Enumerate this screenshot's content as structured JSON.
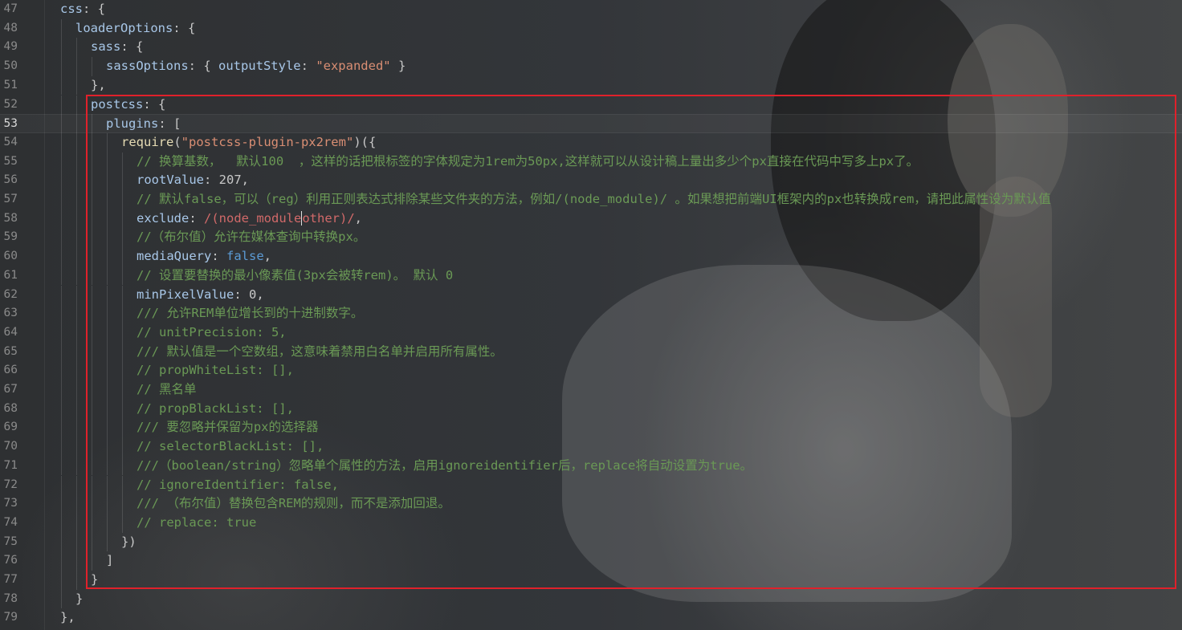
{
  "editor": {
    "theme_colors": {
      "property": "#a8c7e8",
      "function": "#e6dcb4",
      "string": "#d98e73",
      "keyword_bool": "#5b9bd5",
      "regex": "#d16969",
      "comment": "#6a9955",
      "highlight_box": "#e0212b"
    },
    "current_line_number": "53",
    "lines": [
      {
        "n": "47",
        "indent": 0,
        "tokens": [
          {
            "t": "key",
            "v": "css"
          },
          {
            "t": "punct",
            "v": ": {"
          }
        ]
      },
      {
        "n": "48",
        "indent": 1,
        "tokens": [
          {
            "t": "key",
            "v": "loaderOptions"
          },
          {
            "t": "punct",
            "v": ": {"
          }
        ]
      },
      {
        "n": "49",
        "indent": 2,
        "tokens": [
          {
            "t": "key",
            "v": "sass"
          },
          {
            "t": "punct",
            "v": ": {"
          }
        ]
      },
      {
        "n": "50",
        "indent": 3,
        "tokens": [
          {
            "t": "key",
            "v": "sassOptions"
          },
          {
            "t": "punct",
            "v": ": { "
          },
          {
            "t": "key",
            "v": "outputStyle"
          },
          {
            "t": "punct",
            "v": ": "
          },
          {
            "t": "str",
            "v": "\"expanded\""
          },
          {
            "t": "punct",
            "v": " }"
          }
        ]
      },
      {
        "n": "51",
        "indent": 2,
        "tokens": [
          {
            "t": "punct",
            "v": "},"
          }
        ]
      },
      {
        "n": "52",
        "indent": 2,
        "tokens": [
          {
            "t": "key",
            "v": "postcss"
          },
          {
            "t": "punct",
            "v": ": {"
          }
        ]
      },
      {
        "n": "53",
        "indent": 3,
        "tokens": [
          {
            "t": "key",
            "v": "plugins"
          },
          {
            "t": "punct",
            "v": ": ["
          }
        ]
      },
      {
        "n": "54",
        "indent": 4,
        "tokens": [
          {
            "t": "fn",
            "v": "require"
          },
          {
            "t": "punct",
            "v": "("
          },
          {
            "t": "str",
            "v": "\"postcss-plugin-px2rem\""
          },
          {
            "t": "punct",
            "v": ")({"
          }
        ]
      },
      {
        "n": "55",
        "indent": 5,
        "tokens": [
          {
            "t": "cm",
            "v": "// 换算基数，  默认100  ，这样的话把根标签的字体规定为1rem为50px,这样就可以从设计稿上量出多少个px直接在代码中写多上px了。"
          }
        ]
      },
      {
        "n": "56",
        "indent": 5,
        "tokens": [
          {
            "t": "key",
            "v": "rootValue"
          },
          {
            "t": "punct",
            "v": ": "
          },
          {
            "t": "num",
            "v": "207"
          },
          {
            "t": "punct",
            "v": ","
          }
        ]
      },
      {
        "n": "57",
        "indent": 5,
        "tokens": [
          {
            "t": "cm",
            "v": "// 默认false，可以（reg）利用正则表达式排除某些文件夹的方法，例如/(node_module)/ 。如果想把前端UI框架内的px也转换成rem，请把此属性设为默认值"
          }
        ]
      },
      {
        "n": "58",
        "indent": 5,
        "tokens": [
          {
            "t": "key",
            "v": "exclude"
          },
          {
            "t": "punct",
            "v": ": "
          },
          {
            "t": "regex",
            "v": "/(node_module"
          },
          {
            "t": "cursor",
            "v": ""
          },
          {
            "t": "regex",
            "v": "other)/"
          },
          {
            "t": "punct",
            "v": ","
          }
        ]
      },
      {
        "n": "59",
        "indent": 5,
        "tokens": [
          {
            "t": "cm",
            "v": "//（布尔值）允许在媒体查询中转换px。"
          }
        ]
      },
      {
        "n": "60",
        "indent": 5,
        "tokens": [
          {
            "t": "key",
            "v": "mediaQuery"
          },
          {
            "t": "punct",
            "v": ": "
          },
          {
            "t": "bool",
            "v": "false"
          },
          {
            "t": "punct",
            "v": ","
          }
        ]
      },
      {
        "n": "61",
        "indent": 5,
        "tokens": [
          {
            "t": "cm",
            "v": "// 设置要替换的最小像素值(3px会被转rem)。 默认 0"
          }
        ]
      },
      {
        "n": "62",
        "indent": 5,
        "tokens": [
          {
            "t": "key",
            "v": "minPixelValue"
          },
          {
            "t": "punct",
            "v": ": "
          },
          {
            "t": "num",
            "v": "0"
          },
          {
            "t": "punct",
            "v": ","
          }
        ]
      },
      {
        "n": "63",
        "indent": 5,
        "tokens": [
          {
            "t": "cm",
            "v": "/// 允许REM单位增长到的十进制数字。"
          }
        ]
      },
      {
        "n": "64",
        "indent": 5,
        "tokens": [
          {
            "t": "cm",
            "v": "// unitPrecision: 5,"
          }
        ]
      },
      {
        "n": "65",
        "indent": 5,
        "tokens": [
          {
            "t": "cm",
            "v": "/// 默认值是一个空数组，这意味着禁用白名单并启用所有属性。"
          }
        ]
      },
      {
        "n": "66",
        "indent": 5,
        "tokens": [
          {
            "t": "cm",
            "v": "// propWhiteList: [],"
          }
        ]
      },
      {
        "n": "67",
        "indent": 5,
        "tokens": [
          {
            "t": "cm",
            "v": "// 黑名单"
          }
        ]
      },
      {
        "n": "68",
        "indent": 5,
        "tokens": [
          {
            "t": "cm",
            "v": "// propBlackList: [],"
          }
        ]
      },
      {
        "n": "69",
        "indent": 5,
        "tokens": [
          {
            "t": "cm",
            "v": "/// 要忽略并保留为px的选择器"
          }
        ]
      },
      {
        "n": "70",
        "indent": 5,
        "tokens": [
          {
            "t": "cm",
            "v": "// selectorBlackList: [],"
          }
        ]
      },
      {
        "n": "71",
        "indent": 5,
        "tokens": [
          {
            "t": "cm",
            "v": "///（boolean/string）忽略单个属性的方法，启用ignoreidentifier后，replace将自动设置为true。"
          }
        ]
      },
      {
        "n": "72",
        "indent": 5,
        "tokens": [
          {
            "t": "cm",
            "v": "// ignoreIdentifier: false,"
          }
        ]
      },
      {
        "n": "73",
        "indent": 5,
        "tokens": [
          {
            "t": "cm",
            "v": "/// （布尔值）替换包含REM的规则，而不是添加回退。"
          }
        ]
      },
      {
        "n": "74",
        "indent": 5,
        "tokens": [
          {
            "t": "cm",
            "v": "// replace: true"
          }
        ]
      },
      {
        "n": "75",
        "indent": 4,
        "tokens": [
          {
            "t": "punct",
            "v": "})"
          }
        ]
      },
      {
        "n": "76",
        "indent": 3,
        "tokens": [
          {
            "t": "punct",
            "v": "]"
          }
        ]
      },
      {
        "n": "77",
        "indent": 2,
        "tokens": [
          {
            "t": "punct",
            "v": "}"
          }
        ]
      },
      {
        "n": "78",
        "indent": 1,
        "tokens": [
          {
            "t": "punct",
            "v": "}"
          }
        ]
      },
      {
        "n": "79",
        "indent": 0,
        "tokens": [
          {
            "t": "punct",
            "v": "},"
          }
        ]
      }
    ]
  }
}
